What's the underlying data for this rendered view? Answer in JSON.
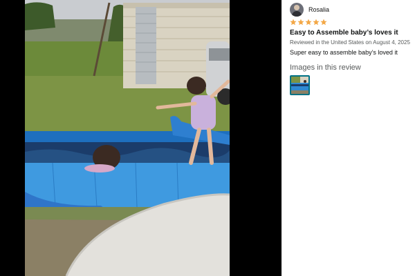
{
  "review": {
    "reviewer_name": "Rosalia",
    "rating": 5,
    "rating_color": "#f3a847",
    "title": "Easy to Assemble baby’s loves it",
    "meta": "Reviewed in the United States on August 4, 2025",
    "body": "Super easy to assemble baby’s loved it",
    "images_heading": "Images in this review"
  },
  "icons": {
    "avatar": "user-avatar",
    "star": "star-icon",
    "thumbnail": "review-image-thumbnail"
  },
  "colors": {
    "pool": "#2f8ad4",
    "media_background": "#000000",
    "thumb_border": "#007185"
  }
}
